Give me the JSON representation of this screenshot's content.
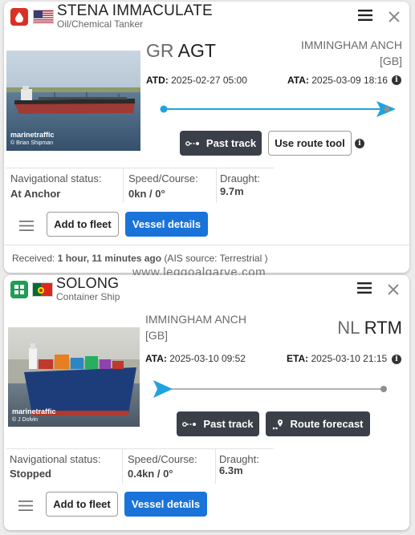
{
  "watermark": "www.leggoalgarve.com",
  "colors": {
    "accent_blue": "#1a73d9",
    "route_line": "#1ea3e0",
    "dark_button": "#3a3f48",
    "tanker_badge": "#d93025",
    "cargo_badge": "#1f9d55"
  },
  "vessels": [
    {
      "name": "STENA IMMACULATE",
      "type": "Oil/Chemical Tanker",
      "type_icon": "tanker-drop-icon",
      "flag_icon": "us-flag-icon",
      "photo_credit_brand": "marinetraffic",
      "photo_credit_author": "© Brian Shipman",
      "origin": {
        "country": "GR",
        "port": "AGT"
      },
      "destination": {
        "name": "IMMINGHAM ANCH",
        "country": "[GB]"
      },
      "left_time": {
        "label": "ATD:",
        "value": "2025-02-27 05:00"
      },
      "right_time": {
        "label": "ATA:",
        "value": "2025-03-09 18:16"
      },
      "buttons": {
        "track": "Past track",
        "route": "Use route tool",
        "fleet": "Add to fleet",
        "details": "Vessel details"
      },
      "nav_status": {
        "label": "Navigational status:",
        "value": "At Anchor"
      },
      "speed_course": {
        "label": "Speed/Course:",
        "value": "0kn / 0°"
      },
      "draught": {
        "label": "Draught:",
        "value": "9.7m"
      },
      "received": {
        "label": "Received:",
        "value": "1 hour, 11 minutes ago",
        "source": "(AIS source: Terrestrial )"
      }
    },
    {
      "name": "SOLONG",
      "type": "Container Ship",
      "type_icon": "cargo-grid-icon",
      "flag_icon": "pt-flag-icon",
      "photo_credit_brand": "marinetraffic",
      "photo_credit_author": "© J Dolvin",
      "origin": {
        "name": "IMMINGHAM ANCH",
        "country": "[GB]"
      },
      "destination": {
        "country": "NL",
        "port": "RTM"
      },
      "left_time": {
        "label": "ATA:",
        "value": "2025-03-10 09:52"
      },
      "right_time": {
        "label": "ETA:",
        "value": "2025-03-10 21:15"
      },
      "buttons": {
        "track": "Past track",
        "route": "Route forecast",
        "fleet": "Add to fleet",
        "details": "Vessel details"
      },
      "nav_status": {
        "label": "Navigational status:",
        "value": "Stopped"
      },
      "speed_course": {
        "label": "Speed/Course:",
        "value": "0.4kn / 0°"
      },
      "draught": {
        "label": "Draught:",
        "value": "6.3m"
      }
    }
  ]
}
